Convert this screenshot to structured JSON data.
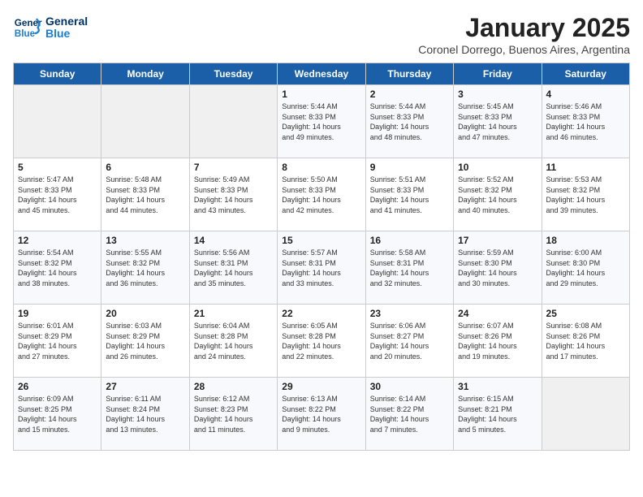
{
  "logo": {
    "line1": "General",
    "line2": "Blue"
  },
  "title": "January 2025",
  "subtitle": "Coronel Dorrego, Buenos Aires, Argentina",
  "days_of_week": [
    "Sunday",
    "Monday",
    "Tuesday",
    "Wednesday",
    "Thursday",
    "Friday",
    "Saturday"
  ],
  "weeks": [
    [
      {
        "day": "",
        "info": ""
      },
      {
        "day": "",
        "info": ""
      },
      {
        "day": "",
        "info": ""
      },
      {
        "day": "1",
        "info": "Sunrise: 5:44 AM\nSunset: 8:33 PM\nDaylight: 14 hours\nand 49 minutes."
      },
      {
        "day": "2",
        "info": "Sunrise: 5:44 AM\nSunset: 8:33 PM\nDaylight: 14 hours\nand 48 minutes."
      },
      {
        "day": "3",
        "info": "Sunrise: 5:45 AM\nSunset: 8:33 PM\nDaylight: 14 hours\nand 47 minutes."
      },
      {
        "day": "4",
        "info": "Sunrise: 5:46 AM\nSunset: 8:33 PM\nDaylight: 14 hours\nand 46 minutes."
      }
    ],
    [
      {
        "day": "5",
        "info": "Sunrise: 5:47 AM\nSunset: 8:33 PM\nDaylight: 14 hours\nand 45 minutes."
      },
      {
        "day": "6",
        "info": "Sunrise: 5:48 AM\nSunset: 8:33 PM\nDaylight: 14 hours\nand 44 minutes."
      },
      {
        "day": "7",
        "info": "Sunrise: 5:49 AM\nSunset: 8:33 PM\nDaylight: 14 hours\nand 43 minutes."
      },
      {
        "day": "8",
        "info": "Sunrise: 5:50 AM\nSunset: 8:33 PM\nDaylight: 14 hours\nand 42 minutes."
      },
      {
        "day": "9",
        "info": "Sunrise: 5:51 AM\nSunset: 8:33 PM\nDaylight: 14 hours\nand 41 minutes."
      },
      {
        "day": "10",
        "info": "Sunrise: 5:52 AM\nSunset: 8:32 PM\nDaylight: 14 hours\nand 40 minutes."
      },
      {
        "day": "11",
        "info": "Sunrise: 5:53 AM\nSunset: 8:32 PM\nDaylight: 14 hours\nand 39 minutes."
      }
    ],
    [
      {
        "day": "12",
        "info": "Sunrise: 5:54 AM\nSunset: 8:32 PM\nDaylight: 14 hours\nand 38 minutes."
      },
      {
        "day": "13",
        "info": "Sunrise: 5:55 AM\nSunset: 8:32 PM\nDaylight: 14 hours\nand 36 minutes."
      },
      {
        "day": "14",
        "info": "Sunrise: 5:56 AM\nSunset: 8:31 PM\nDaylight: 14 hours\nand 35 minutes."
      },
      {
        "day": "15",
        "info": "Sunrise: 5:57 AM\nSunset: 8:31 PM\nDaylight: 14 hours\nand 33 minutes."
      },
      {
        "day": "16",
        "info": "Sunrise: 5:58 AM\nSunset: 8:31 PM\nDaylight: 14 hours\nand 32 minutes."
      },
      {
        "day": "17",
        "info": "Sunrise: 5:59 AM\nSunset: 8:30 PM\nDaylight: 14 hours\nand 30 minutes."
      },
      {
        "day": "18",
        "info": "Sunrise: 6:00 AM\nSunset: 8:30 PM\nDaylight: 14 hours\nand 29 minutes."
      }
    ],
    [
      {
        "day": "19",
        "info": "Sunrise: 6:01 AM\nSunset: 8:29 PM\nDaylight: 14 hours\nand 27 minutes."
      },
      {
        "day": "20",
        "info": "Sunrise: 6:03 AM\nSunset: 8:29 PM\nDaylight: 14 hours\nand 26 minutes."
      },
      {
        "day": "21",
        "info": "Sunrise: 6:04 AM\nSunset: 8:28 PM\nDaylight: 14 hours\nand 24 minutes."
      },
      {
        "day": "22",
        "info": "Sunrise: 6:05 AM\nSunset: 8:28 PM\nDaylight: 14 hours\nand 22 minutes."
      },
      {
        "day": "23",
        "info": "Sunrise: 6:06 AM\nSunset: 8:27 PM\nDaylight: 14 hours\nand 20 minutes."
      },
      {
        "day": "24",
        "info": "Sunrise: 6:07 AM\nSunset: 8:26 PM\nDaylight: 14 hours\nand 19 minutes."
      },
      {
        "day": "25",
        "info": "Sunrise: 6:08 AM\nSunset: 8:26 PM\nDaylight: 14 hours\nand 17 minutes."
      }
    ],
    [
      {
        "day": "26",
        "info": "Sunrise: 6:09 AM\nSunset: 8:25 PM\nDaylight: 14 hours\nand 15 minutes."
      },
      {
        "day": "27",
        "info": "Sunrise: 6:11 AM\nSunset: 8:24 PM\nDaylight: 14 hours\nand 13 minutes."
      },
      {
        "day": "28",
        "info": "Sunrise: 6:12 AM\nSunset: 8:23 PM\nDaylight: 14 hours\nand 11 minutes."
      },
      {
        "day": "29",
        "info": "Sunrise: 6:13 AM\nSunset: 8:22 PM\nDaylight: 14 hours\nand 9 minutes."
      },
      {
        "day": "30",
        "info": "Sunrise: 6:14 AM\nSunset: 8:22 PM\nDaylight: 14 hours\nand 7 minutes."
      },
      {
        "day": "31",
        "info": "Sunrise: 6:15 AM\nSunset: 8:21 PM\nDaylight: 14 hours\nand 5 minutes."
      },
      {
        "day": "",
        "info": ""
      }
    ]
  ]
}
